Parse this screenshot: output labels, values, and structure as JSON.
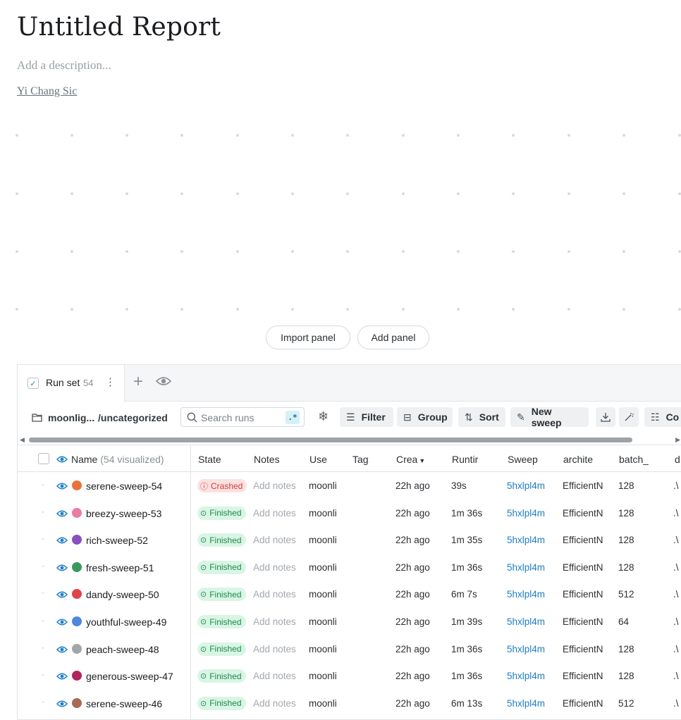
{
  "report": {
    "title": "Untitled Report",
    "description_placeholder": "Add a description...",
    "author": "Yi Chang Sic"
  },
  "panel_buttons": {
    "import": "Import panel",
    "add": "Add panel"
  },
  "runset": {
    "tab_label": "Run set",
    "count": "54",
    "project": "moonlig...",
    "project_sub": "/uncategorized",
    "search_placeholder": "Search runs",
    "regex_label": ".*",
    "filter": "Filter",
    "group": "Group",
    "sort": "Sort",
    "new_sweep": "New sweep",
    "columns": "Co"
  },
  "table": {
    "headers": {
      "name": "Name",
      "visualized": "(54 visualized)",
      "state": "State",
      "notes": "Notes",
      "user": "Use",
      "tags": "Tag:",
      "created": "Crea",
      "runtime": "Runtir",
      "sweep": "Sweep",
      "architecture": "archite",
      "batch": "batch_",
      "extra": "d"
    },
    "rows": [
      {
        "name": "serene-sweep-54",
        "color": "#e8733a",
        "state": "Crashed",
        "notes": "Add notes",
        "user": "moonli",
        "created": "22h ago",
        "runtime": "39s",
        "sweep": "5hxlpl4m",
        "arch": "EfficientN",
        "batch": "128",
        "extra": ".\\"
      },
      {
        "name": "breezy-sweep-53",
        "color": "#e97ba5",
        "state": "Finished",
        "notes": "Add notes",
        "user": "moonli",
        "created": "22h ago",
        "runtime": "1m 36s",
        "sweep": "5hxlpl4m",
        "arch": "EfficientN",
        "batch": "128",
        "extra": ".\\"
      },
      {
        "name": "rich-sweep-52",
        "color": "#8a4fbf",
        "state": "Finished",
        "notes": "Add notes",
        "user": "moonli",
        "created": "22h ago",
        "runtime": "1m 35s",
        "sweep": "5hxlpl4m",
        "arch": "EfficientN",
        "batch": "128",
        "extra": ".\\"
      },
      {
        "name": "fresh-sweep-51",
        "color": "#3a9a5b",
        "state": "Finished",
        "notes": "Add notes",
        "user": "moonli",
        "created": "22h ago",
        "runtime": "1m 36s",
        "sweep": "5hxlpl4m",
        "arch": "EfficientN",
        "batch": "128",
        "extra": ".\\"
      },
      {
        "name": "dandy-sweep-50",
        "color": "#e0454a",
        "state": "Finished",
        "notes": "Add notes",
        "user": "moonli",
        "created": "22h ago",
        "runtime": "6m 7s",
        "sweep": "5hxlpl4m",
        "arch": "EfficientN",
        "batch": "512",
        "extra": ".\\"
      },
      {
        "name": "youthful-sweep-49",
        "color": "#4f86e0",
        "state": "Finished",
        "notes": "Add notes",
        "user": "moonli",
        "created": "22h ago",
        "runtime": "1m 39s",
        "sweep": "5hxlpl4m",
        "arch": "EfficientN",
        "batch": "64",
        "extra": ".\\"
      },
      {
        "name": "peach-sweep-48",
        "color": "#a3a6a9",
        "state": "Finished",
        "notes": "Add notes",
        "user": "moonli",
        "created": "22h ago",
        "runtime": "1m 36s",
        "sweep": "5hxlpl4m",
        "arch": "EfficientN",
        "batch": "128",
        "extra": ".\\"
      },
      {
        "name": "generous-sweep-47",
        "color": "#b0245c",
        "state": "Finished",
        "notes": "Add notes",
        "user": "moonli",
        "created": "22h ago",
        "runtime": "1m 36s",
        "sweep": "5hxlpl4m",
        "arch": "EfficientN",
        "batch": "128",
        "extra": ".\\"
      },
      {
        "name": "serene-sweep-46",
        "color": "#a86a55",
        "state": "Finished",
        "notes": "Add notes",
        "user": "moonli",
        "created": "22h ago",
        "runtime": "6m 13s",
        "sweep": "5hxlpl4m",
        "arch": "EfficientN",
        "batch": "512",
        "extra": ".\\"
      }
    ]
  }
}
